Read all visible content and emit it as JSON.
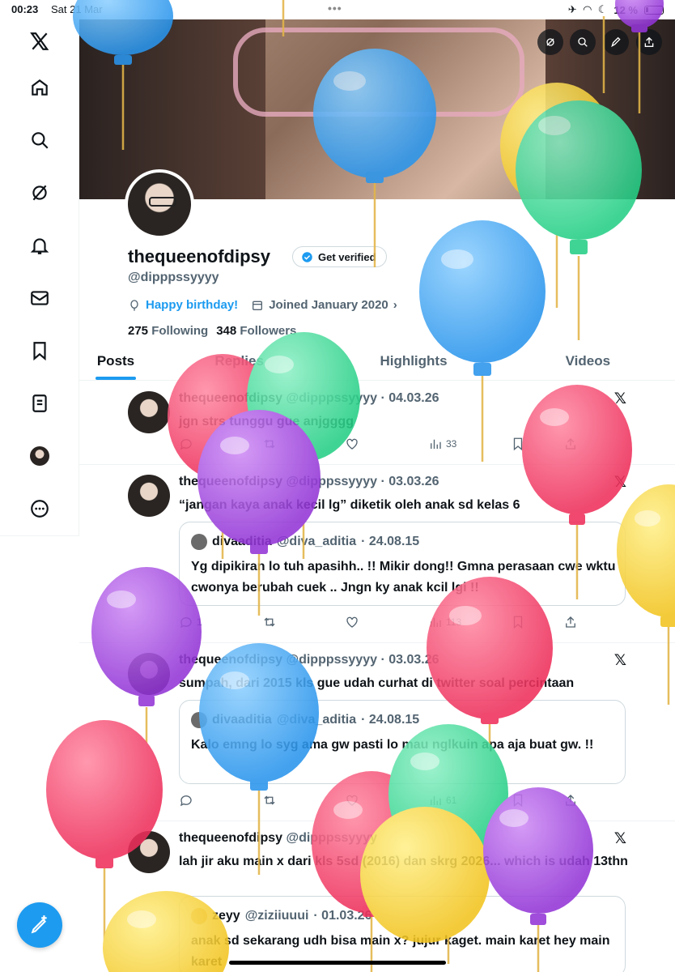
{
  "status_bar": {
    "time": "00:23",
    "date": "Sat 21 Mar",
    "battery": "12 %"
  },
  "sidebar": {
    "items": [
      {
        "icon": "x-logo-icon"
      },
      {
        "icon": "home-icon"
      },
      {
        "icon": "search-icon"
      },
      {
        "icon": "grok-icon"
      },
      {
        "icon": "bell-icon"
      },
      {
        "icon": "mail-icon"
      },
      {
        "icon": "bookmark-icon"
      },
      {
        "icon": "list-icon"
      },
      {
        "icon": "avatar"
      },
      {
        "icon": "more-icon"
      }
    ],
    "compose_icon": "compose-icon"
  },
  "profile": {
    "name": "thequeenofdipsy",
    "verify_label": "Get verified",
    "handle": "@dipppssyyyy",
    "birthday": "Happy birthday!",
    "joined": "Joined January 2020",
    "following_count": "275",
    "following_label": "Following",
    "followers_count": "348",
    "followers_label": "Followers"
  },
  "tabs": [
    "Posts",
    "Replies",
    "Highlights",
    "Videos"
  ],
  "posts": [
    {
      "name": "thequeenofdipsy",
      "handle": "@dipppssyyyy",
      "date": "· 04.03.26",
      "text": "jgn strs tunggu gue anjgggg",
      "views": "33"
    },
    {
      "name": "thequeenofdipsy",
      "handle": "@dipppssyyyy",
      "date": "· 03.03.26",
      "text": "“jangan kaya anak kecil lg” diketik oleh anak sd kelas 6",
      "quote": {
        "name": "divaaditia",
        "handle": "@diva_aditia",
        "date": "· 24.08.15",
        "text": "Yg dipikiran lo tuh apasihh.. !! Mikir dong!! Gmna perasaan cwe wktu cwonya berubah cuek .. Jngn ky anak kcil lgi !!"
      },
      "replies": "1",
      "views": "113"
    },
    {
      "name": "thequeenofdipsy",
      "handle": "@dipppssyyyy",
      "date": "· 03.03.26",
      "text": "sumpah, dari 2015 kls gue udah curhat di twitter soal percintaan",
      "quote": {
        "name": "divaaditia",
        "handle": "@diva_aditia",
        "date": "· 24.08.15",
        "text": "Kalo emng lo syg ama gw pasti lo mau nglkuin apa aja buat gw. !!"
      },
      "views": "61"
    },
    {
      "name": "thequeenofdipsy",
      "handle": "@dipppssyyyy",
      "date": "",
      "text": "lah jir aku main x dari kls 5sd (2016) dan skrg 2026... which is udah 13thn",
      "quote": {
        "name": "zeyy",
        "handle": "@ziziiuuui",
        "date": "· 01.03.26",
        "text": "anak sd sekarang udh bisa main x? jujur kaget. main karet hey main karet"
      }
    }
  ],
  "colors": {
    "accent": "#1d9bf0",
    "balloon_blue": "#3aa6f2",
    "balloon_green": "#3ddc97",
    "balloon_pink": "#f2456b",
    "balloon_purple": "#a34ee0",
    "balloon_yellow": "#f5cf3a"
  }
}
